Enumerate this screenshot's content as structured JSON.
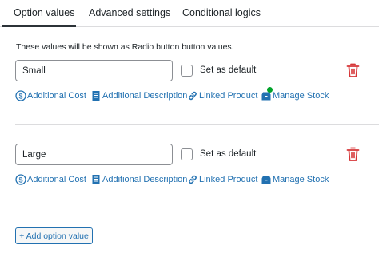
{
  "tabs": [
    {
      "label": "Option values",
      "active": true
    },
    {
      "label": "Advanced settings",
      "active": false
    },
    {
      "label": "Conditional logics",
      "active": false
    }
  ],
  "description": "These values will be shown as Radio button button values.",
  "options": [
    {
      "value": "Small",
      "default_label": "Set as default",
      "actions": {
        "cost": "Additional Cost",
        "description": "Additional Description",
        "product": "Linked Product",
        "stock": "Manage Stock"
      },
      "stock_indicator": true
    },
    {
      "value": "Large",
      "default_label": "Set as default",
      "actions": {
        "cost": "Additional Cost",
        "description": "Additional Description",
        "product": "Linked Product",
        "stock": "Manage Stock"
      },
      "stock_indicator": false
    }
  ],
  "add_button": "+ Add option value",
  "colors": {
    "link": "#2271b1",
    "delete": "#d63638",
    "stock_dot": "#00a32a"
  }
}
